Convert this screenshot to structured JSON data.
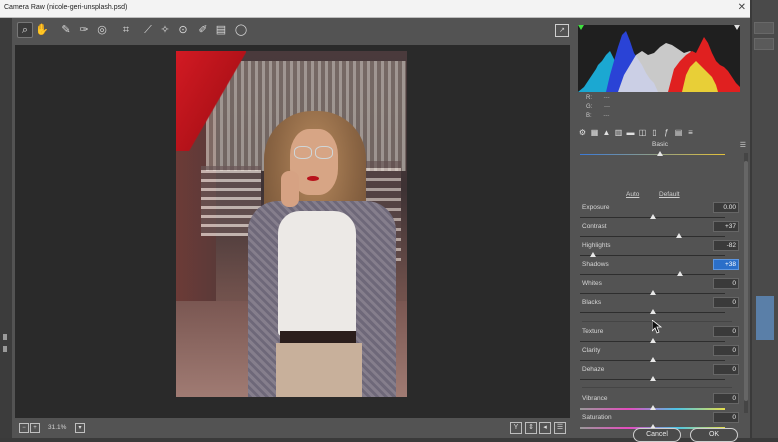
{
  "window": {
    "title": "Camera Raw (nicole-geri-unsplash.psd)"
  },
  "toolbar": {
    "tools": [
      {
        "name": "zoom-tool-icon",
        "glyph": "⌕"
      },
      {
        "name": "hand-tool-icon",
        "glyph": "✋"
      },
      {
        "name": "white-balance-tool-icon",
        "glyph": "✎"
      },
      {
        "name": "color-sampler-tool-icon",
        "glyph": "✑"
      },
      {
        "name": "targeted-adjustment-tool-icon",
        "glyph": "◎"
      },
      {
        "name": "crop-tool-icon",
        "glyph": "⌗"
      },
      {
        "name": "straighten-tool-icon",
        "glyph": "⟋"
      },
      {
        "name": "spot-removal-tool-icon",
        "glyph": "✧"
      },
      {
        "name": "red-eye-tool-icon",
        "glyph": "⊙"
      },
      {
        "name": "adjustment-brush-icon",
        "glyph": "✐"
      },
      {
        "name": "graduated-filter-icon",
        "glyph": "▤"
      },
      {
        "name": "radial-filter-icon",
        "glyph": "◯"
      }
    ]
  },
  "status": {
    "zoom": "31.1%"
  },
  "histogram": {
    "r": "---",
    "g": "---",
    "b": "---"
  },
  "panel": {
    "section": "Basic",
    "auto": "Auto",
    "default": "Default",
    "sliders": [
      {
        "label": "Exposure",
        "value": "0.00",
        "level": 0.5
      },
      {
        "label": "Contrast",
        "value": "+37",
        "level": 0.685
      },
      {
        "label": "Highlights",
        "value": "-82",
        "level": 0.09
      },
      {
        "label": "Shadows",
        "value": "+38",
        "level": 0.69
      },
      {
        "label": "Whites",
        "value": "0",
        "level": 0.5
      },
      {
        "label": "Blacks",
        "value": "0",
        "level": 0.5
      },
      {
        "label": "Texture",
        "value": "0",
        "level": 0.5
      },
      {
        "label": "Clarity",
        "value": "0",
        "level": 0.5
      },
      {
        "label": "Dehaze",
        "value": "0",
        "level": 0.5
      },
      {
        "label": "Vibrance",
        "value": "0",
        "level": 0.5
      },
      {
        "label": "Saturation",
        "value": "0",
        "level": 0.5
      }
    ]
  },
  "buttons": {
    "cancel": "Cancel",
    "ok": "OK"
  },
  "colors": {
    "accent": "#2b6fc9",
    "panel": "#535353"
  }
}
